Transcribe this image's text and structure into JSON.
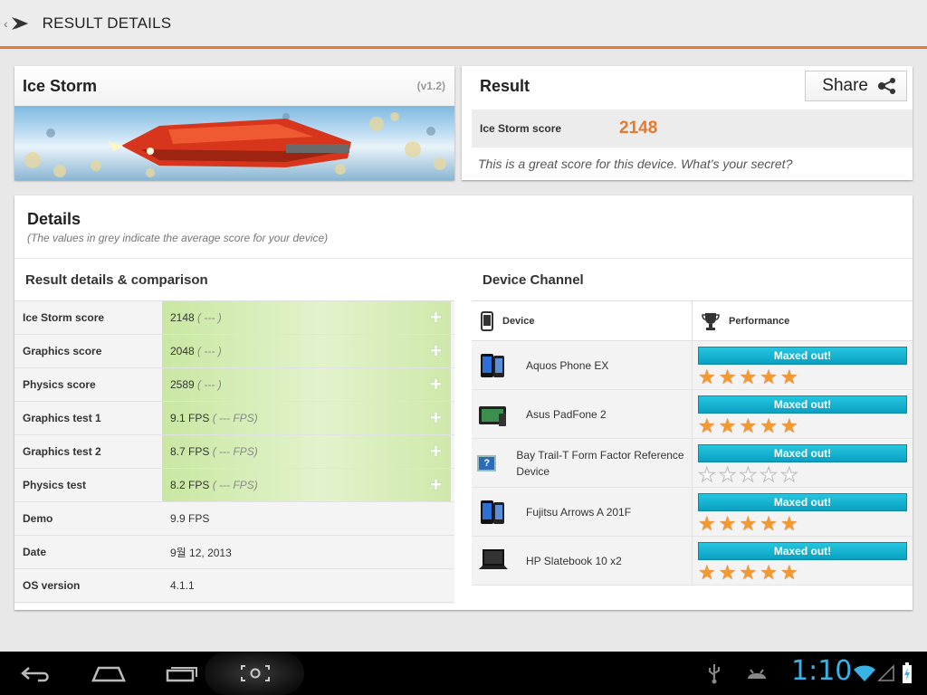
{
  "topbar": {
    "title": "RESULT DETAILS"
  },
  "ice_storm": {
    "title": "Ice Storm",
    "version": "(v1.2)"
  },
  "result": {
    "title": "Result",
    "share_label": "Share",
    "score_label": "Ice Storm score",
    "score_value": "2148",
    "message": "This is a great score for this device. What's your secret?"
  },
  "details": {
    "title": "Details",
    "subtitle": "(The values in grey indicate the average score for your device)",
    "left_heading": "Result details & comparison",
    "rows": [
      {
        "label": "Ice Storm score",
        "value": "2148",
        "avg": "( --- )",
        "expandable": true
      },
      {
        "label": "Graphics score",
        "value": "2048",
        "avg": "( --- )",
        "expandable": true
      },
      {
        "label": "Physics score",
        "value": "2589",
        "avg": "( --- )",
        "expandable": true
      },
      {
        "label": "Graphics test 1",
        "value": "9.1 FPS",
        "avg": "( --- FPS)",
        "expandable": true
      },
      {
        "label": "Graphics test 2",
        "value": "8.7 FPS",
        "avg": "( --- FPS)",
        "expandable": true
      },
      {
        "label": "Physics test",
        "value": "8.2 FPS",
        "avg": "( --- FPS)",
        "expandable": true
      },
      {
        "label": "Demo",
        "value": "9.9 FPS",
        "avg": "",
        "expandable": false
      },
      {
        "label": "Date",
        "value": "9월 12, 2013",
        "avg": "",
        "expandable": false
      },
      {
        "label": "OS version",
        "value": "4.1.1",
        "avg": "",
        "expandable": false
      }
    ],
    "right_heading": "Device Channel",
    "device_col": "Device",
    "performance_col": "Performance",
    "devices": [
      {
        "name": "Aquos Phone EX",
        "badge": "Maxed out!",
        "stars": 5,
        "icon": "phone-icon"
      },
      {
        "name": "Asus PadFone 2",
        "badge": "Maxed out!",
        "stars": 5,
        "icon": "tablet-icon"
      },
      {
        "name": "Bay Trail-T Form Factor Reference Device",
        "badge": "Maxed out!",
        "stars": 0,
        "icon": "question-icon"
      },
      {
        "name": "Fujitsu Arrows A 201F",
        "badge": "Maxed out!",
        "stars": 5,
        "icon": "phone-icon"
      },
      {
        "name": "HP Slatebook 10 x2",
        "badge": "Maxed out!",
        "stars": 5,
        "icon": "laptop-icon"
      }
    ]
  },
  "statusbar": {
    "time": "1:10"
  },
  "colors": {
    "accent": "#e8783a",
    "score": "#e8782a",
    "badge": "#12b3d4",
    "star": "#f39a2c",
    "clock": "#39b3e6"
  }
}
